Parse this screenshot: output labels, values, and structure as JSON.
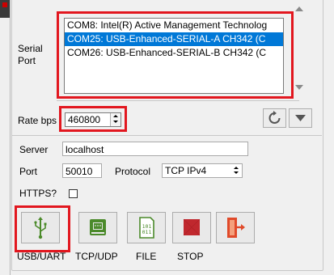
{
  "serial": {
    "label_line1": "Serial",
    "label_line2": "Port",
    "ports": [
      {
        "text": "COM8: Intel(R) Active Management Technolog",
        "selected": false
      },
      {
        "text": "COM25: USB-Enhanced-SERIAL-A CH342 (C",
        "selected": true
      },
      {
        "text": "COM26: USB-Enhanced-SERIAL-B CH342 (C",
        "selected": false
      }
    ]
  },
  "rate": {
    "label": "Rate bps",
    "value": "460800"
  },
  "network": {
    "server_label": "Server",
    "server_value": "localhost",
    "port_label": "Port",
    "port_value": "50010",
    "protocol_label": "Protocol",
    "protocol_value": "TCP IPv4",
    "https_label": "HTTPS?"
  },
  "modes": [
    {
      "label": "USB/UART",
      "icon": "usb-icon"
    },
    {
      "label": "TCP/UDP",
      "icon": "network-board-icon"
    },
    {
      "label": "FILE",
      "icon": "binary-file-icon"
    },
    {
      "label": "STOP",
      "icon": "stop-icon"
    },
    {
      "label": "",
      "icon": "exit-icon"
    }
  ],
  "colors": {
    "highlight": "#e2171f",
    "selection": "#0078d7",
    "icon_green": "#4b8a2a"
  }
}
